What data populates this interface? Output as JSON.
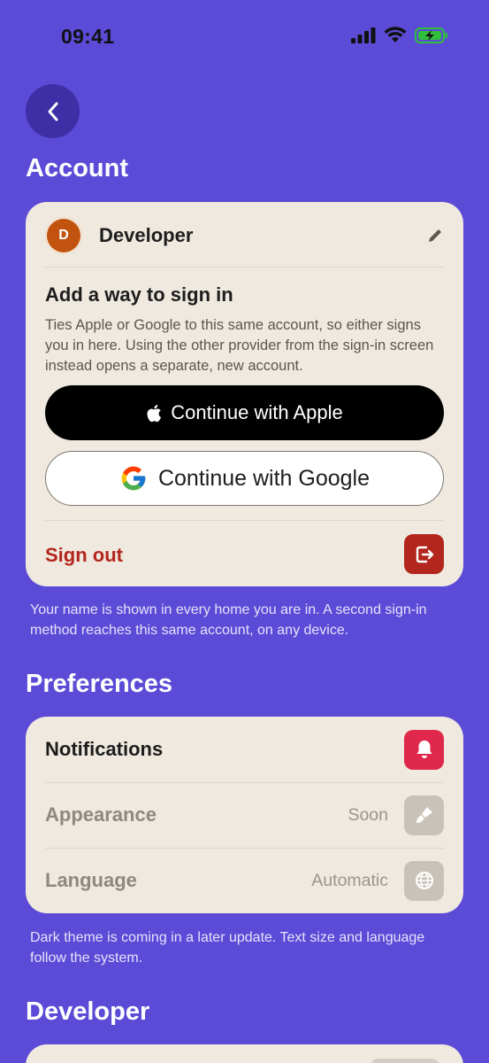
{
  "status_bar": {
    "time": "09:41"
  },
  "header": {
    "back_icon": "chevron-left-icon"
  },
  "account": {
    "section_title": "Account",
    "avatar_initial": "D",
    "name": "Developer",
    "add_signin_title": "Add a way to sign in",
    "add_signin_description": "Ties Apple or Google to this same account, so either signs you in here. Using the other provider from the sign-in screen instead opens a separate, new account.",
    "apple_button": "Continue with Apple",
    "google_button": "Continue with Google",
    "sign_out": "Sign out",
    "footnote": "Your name is shown in every home you are in. A second sign-in method reaches this same account, on any device."
  },
  "preferences": {
    "section_title": "Preferences",
    "notifications_label": "Notifications",
    "appearance_label": "Appearance",
    "appearance_value": "Soon",
    "language_label": "Language",
    "language_value": "Automatic",
    "footnote": "Dark theme is coming in a later update. Text size and language follow the system."
  },
  "developer": {
    "section_title": "Developer"
  },
  "colors": {
    "background": "#5b4bd6",
    "card": "#efe9df",
    "sign_out": "#b3261e",
    "notification_icon_bg": "#e0284d",
    "disabled_icon_bg": "#c8c2b8",
    "avatar": "#c2530e"
  }
}
